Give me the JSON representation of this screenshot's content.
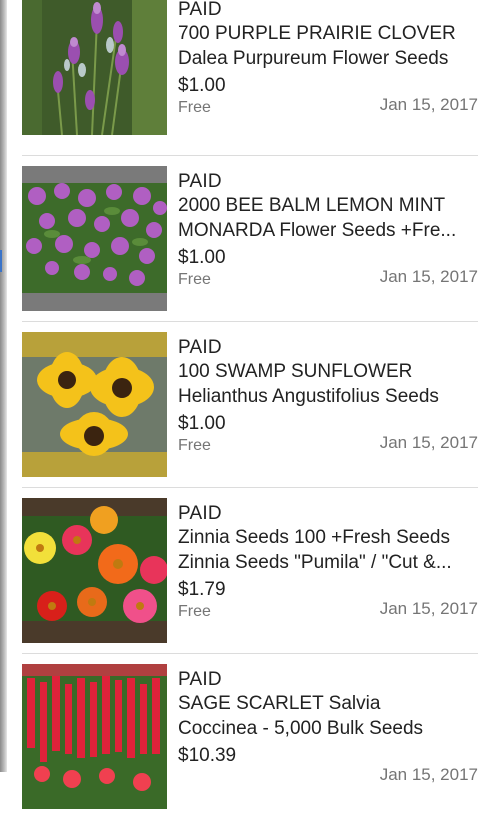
{
  "orders": [
    {
      "status": "PAID",
      "title_line1": "700 PURPLE PRAIRIE CLOVER",
      "title_line2": "Dalea Purpureum Flower Seeds",
      "price": "$1.00",
      "shipping": "Free",
      "date": "Jan 15, 2017",
      "thumbnail": "purple-prairie-clover"
    },
    {
      "status": "PAID",
      "title_line1": "2000 BEE BALM LEMON MINT",
      "title_line2": "MONARDA Flower Seeds +Fre...",
      "price": "$1.00",
      "shipping": "Free",
      "date": "Jan 15, 2017",
      "thumbnail": "bee-balm"
    },
    {
      "status": "PAID",
      "title_line1": "100 SWAMP SUNFLOWER",
      "title_line2": "Helianthus Angustifolius Seeds",
      "price": "$1.00",
      "shipping": "Free",
      "date": "Jan 15, 2017",
      "thumbnail": "swamp-sunflower"
    },
    {
      "status": "PAID",
      "title_line1": "Zinnia Seeds 100 +Fresh Seeds",
      "title_line2": "Zinnia Seeds \"Pumila\" / \"Cut &...",
      "price": "$1.79",
      "shipping": "Free",
      "date": "Jan 15, 2017",
      "thumbnail": "zinnia"
    },
    {
      "status": "PAID",
      "title_line1": "SAGE SCARLET Salvia",
      "title_line2": "Coccinea - 5,000 Bulk Seeds",
      "price": "$10.39",
      "shipping": "",
      "date": "Jan 15, 2017",
      "thumbnail": "scarlet-sage"
    }
  ],
  "colors": {
    "text": "#222222",
    "secondary_text": "#757575",
    "divider": "#dcdcdc"
  }
}
